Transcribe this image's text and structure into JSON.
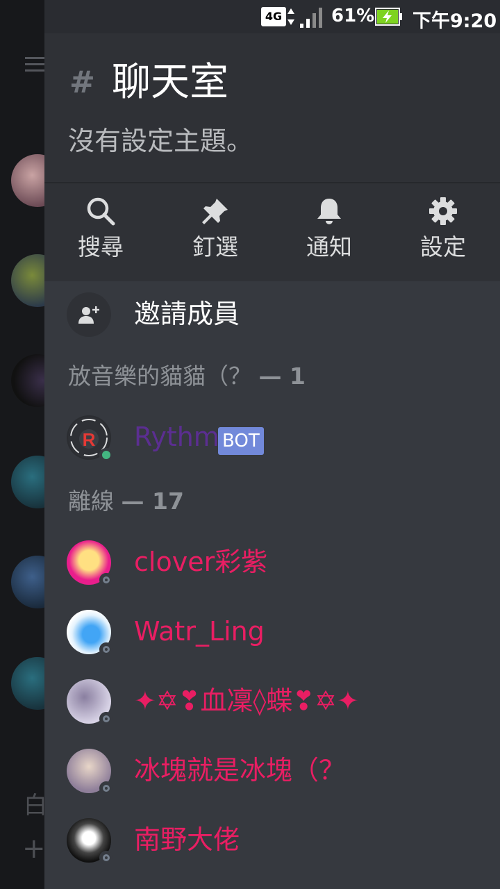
{
  "status_bar": {
    "network": "4G",
    "battery": "61%",
    "time": "下午9:20"
  },
  "rail": {
    "bottom_text": "白",
    "plus": "+"
  },
  "channel": {
    "hash": "#",
    "name": "聊天室",
    "topic": "沒有設定主題。"
  },
  "actions": [
    {
      "label": "搜尋",
      "icon": "search-icon"
    },
    {
      "label": "釘選",
      "icon": "pin-icon"
    },
    {
      "label": "通知",
      "icon": "bell-icon"
    },
    {
      "label": "設定",
      "icon": "gear-icon"
    }
  ],
  "invite": {
    "label": "邀請成員",
    "icon": "add-user-icon"
  },
  "sections": [
    {
      "title": "放音樂的貓貓（？",
      "count": "— 1"
    },
    {
      "title": "離線",
      "count": "— 17"
    }
  ],
  "members": [
    {
      "name": "Rythm",
      "tag": "BOT",
      "status": "online",
      "color": "#5b2e91"
    },
    {
      "name": "clover彩紫",
      "status": "offline",
      "color": "#e91e63"
    },
    {
      "name": "Watr_Ling",
      "status": "offline",
      "color": "#e91e63"
    },
    {
      "name": "✦✡❣血凜◊蝶❣✡✦",
      "status": "offline",
      "color": "#e91e63"
    },
    {
      "name": "冰塊就是冰塊（？",
      "status": "offline",
      "color": "#e91e63"
    },
    {
      "name": "南野大佬",
      "status": "offline",
      "color": "#e91e63"
    }
  ],
  "colors": {
    "drawer_bg": "#36393f",
    "header_bg": "#2f3136",
    "role_color": "#e91e63",
    "bot_color": "#5b2e91",
    "bot_tag_bg": "#7289da",
    "online": "#43b581"
  }
}
